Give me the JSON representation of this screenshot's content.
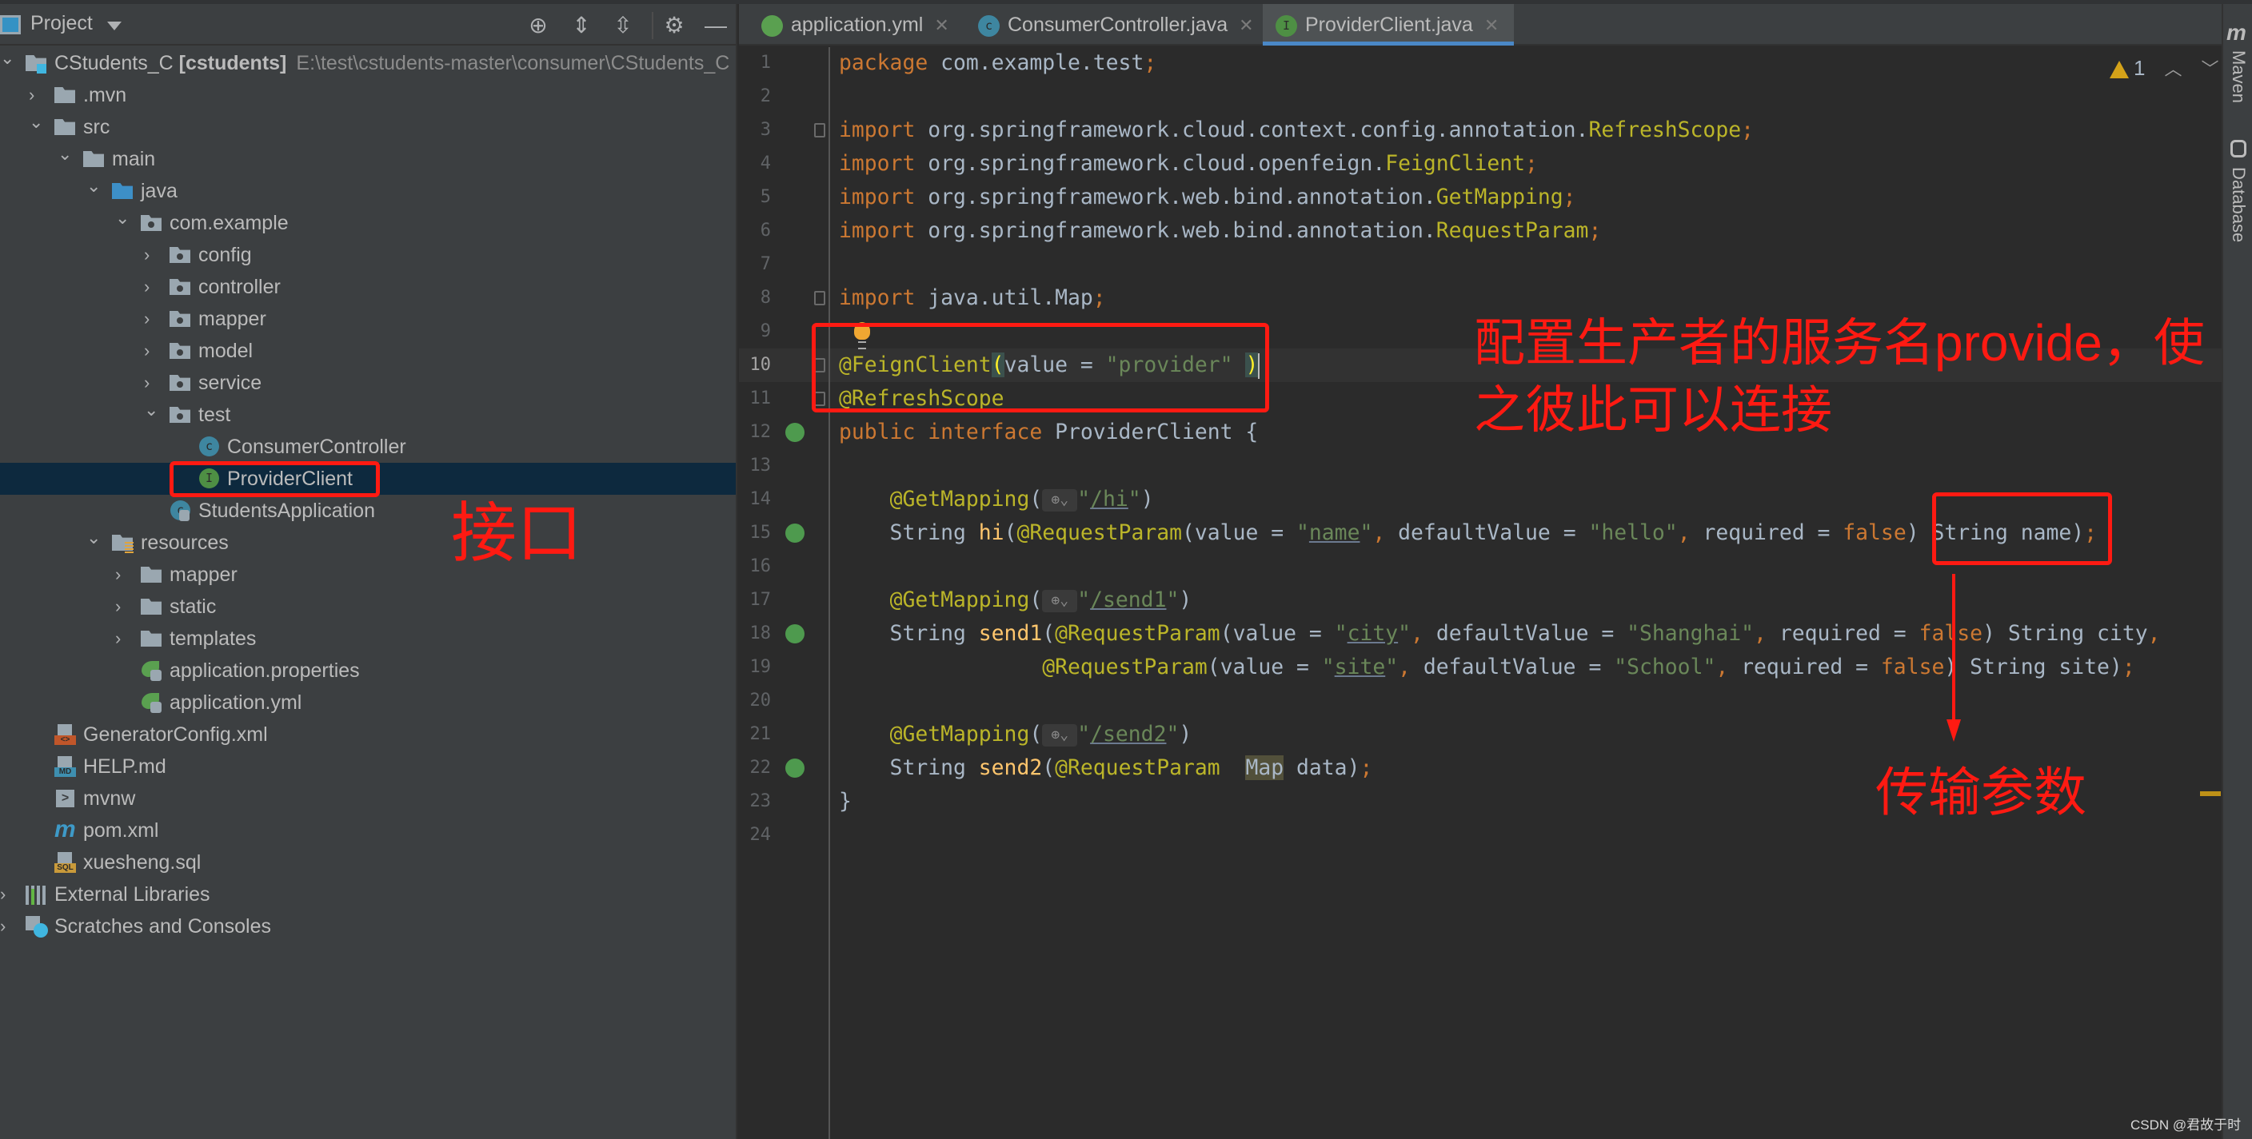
{
  "project_panel": {
    "title": "Project",
    "toolbar": [
      {
        "name": "locate-icon",
        "glyph": "⊕"
      },
      {
        "name": "expand-all-icon",
        "glyph": "⇕"
      },
      {
        "name": "collapse-all-icon",
        "glyph": "⇳"
      },
      {
        "name": "gear-icon",
        "glyph": "⚙"
      },
      {
        "name": "hide-icon",
        "glyph": "—"
      }
    ],
    "tree": [
      {
        "label": "CStudents_C",
        "bold": "[cstudents]",
        "path": "E:\\test\\cstudents-master\\consumer\\CStudents_C",
        "level": 0,
        "expanded": true,
        "icon": "module"
      },
      {
        "label": ".mvn",
        "level": 1,
        "expanded": false,
        "icon": "folder"
      },
      {
        "label": "src",
        "level": 1,
        "expanded": true,
        "icon": "folder"
      },
      {
        "label": "main",
        "level": 2,
        "expanded": true,
        "icon": "folder"
      },
      {
        "label": "java",
        "level": 3,
        "expanded": true,
        "icon": "src-folder"
      },
      {
        "label": "com.example",
        "level": 4,
        "expanded": true,
        "icon": "package"
      },
      {
        "label": "config",
        "level": 5,
        "expanded": false,
        "icon": "package"
      },
      {
        "label": "controller",
        "level": 5,
        "expanded": false,
        "icon": "package"
      },
      {
        "label": "mapper",
        "level": 5,
        "expanded": false,
        "icon": "package"
      },
      {
        "label": "model",
        "level": 5,
        "expanded": false,
        "icon": "package"
      },
      {
        "label": "service",
        "level": 5,
        "expanded": false,
        "icon": "package"
      },
      {
        "label": "test",
        "level": 5,
        "expanded": true,
        "icon": "package"
      },
      {
        "label": "ConsumerController",
        "level": 6,
        "icon": "class"
      },
      {
        "label": "ProviderClient",
        "level": 6,
        "icon": "interface",
        "selected": true
      },
      {
        "label": "StudentsApplication",
        "level": 5,
        "icon": "spring-app"
      },
      {
        "label": "resources",
        "level": 3,
        "expanded": true,
        "icon": "res-folder"
      },
      {
        "label": "mapper",
        "level": 4,
        "expanded": false,
        "icon": "folder"
      },
      {
        "label": "static",
        "level": 4,
        "expanded": false,
        "icon": "folder"
      },
      {
        "label": "templates",
        "level": 4,
        "expanded": false,
        "icon": "folder"
      },
      {
        "label": "application.properties",
        "level": 4,
        "icon": "spring-config"
      },
      {
        "label": "application.yml",
        "level": 4,
        "icon": "spring-config"
      },
      {
        "label": "GeneratorConfig.xml",
        "level": 1,
        "icon": "xml"
      },
      {
        "label": "HELP.md",
        "level": 1,
        "icon": "md"
      },
      {
        "label": "mvnw",
        "level": 1,
        "icon": "shell"
      },
      {
        "label": "pom.xml",
        "level": 1,
        "icon": "maven"
      },
      {
        "label": "xuesheng.sql",
        "level": 1,
        "icon": "sql"
      },
      {
        "label": "External Libraries",
        "level": 0,
        "expanded": false,
        "icon": "libraries"
      },
      {
        "label": "Scratches and Consoles",
        "level": 0,
        "expanded": false,
        "icon": "scratches"
      }
    ]
  },
  "tabs": [
    {
      "label": "application.yml",
      "icon": "spring-config",
      "active": false
    },
    {
      "label": "ConsumerController.java",
      "icon": "class",
      "active": false
    },
    {
      "label": "ProviderClient.java",
      "icon": "interface",
      "active": true
    }
  ],
  "editor": {
    "warnings": "1",
    "current_line": 10,
    "lines": [
      [
        [
          "k",
          "package"
        ],
        [
          "p",
          " com.example.test"
        ],
        [
          "k",
          ";"
        ]
      ],
      [],
      [
        [
          "k",
          "import"
        ],
        [
          "p",
          " org.springframework.cloud.context.config.annotation."
        ],
        [
          "a",
          "RefreshScope"
        ],
        [
          "k",
          ";"
        ]
      ],
      [
        [
          "k",
          "import"
        ],
        [
          "p",
          " org.springframework.cloud.openfeign."
        ],
        [
          "a",
          "FeignClient"
        ],
        [
          "k",
          ";"
        ]
      ],
      [
        [
          "k",
          "import"
        ],
        [
          "p",
          " org.springframework.web.bind.annotation."
        ],
        [
          "a",
          "GetMapping"
        ],
        [
          "k",
          ";"
        ]
      ],
      [
        [
          "k",
          "import"
        ],
        [
          "p",
          " org.springframework.web.bind.annotation."
        ],
        [
          "a",
          "RequestParam"
        ],
        [
          "k",
          ";"
        ]
      ],
      [],
      [
        [
          "k",
          "import"
        ],
        [
          "p",
          " java.util.Map"
        ],
        [
          "k",
          ";"
        ]
      ],
      [],
      [
        [
          "a",
          "@FeignClient"
        ],
        [
          "bm",
          "("
        ],
        [
          "p",
          "value = "
        ],
        [
          "s",
          "\"provider\""
        ],
        [
          "p",
          " "
        ],
        [
          "bm",
          ")"
        ]
      ],
      [
        [
          "a",
          "@RefreshScope"
        ]
      ],
      [
        [
          "k",
          "public interface "
        ],
        [
          "p",
          "ProviderClient {"
        ]
      ],
      [],
      [
        [
          "p",
          "    "
        ],
        [
          "a",
          "@GetMapping"
        ],
        [
          "p",
          "("
        ],
        [
          "h",
          "⊕⌄"
        ],
        [
          "s",
          "\""
        ],
        [
          "su",
          "/hi"
        ],
        [
          "s",
          "\""
        ],
        [
          "p",
          ")"
        ]
      ],
      [
        [
          "p",
          "    String "
        ],
        [
          "m",
          "hi"
        ],
        [
          "p",
          "("
        ],
        [
          "a",
          "@RequestParam"
        ],
        [
          "p",
          "(value = "
        ],
        [
          "s",
          "\""
        ],
        [
          "su",
          "name"
        ],
        [
          "s",
          "\""
        ],
        [
          "k",
          ", "
        ],
        [
          "p",
          "defaultValue = "
        ],
        [
          "s",
          "\"hello\""
        ],
        [
          "k",
          ", "
        ],
        [
          "p",
          "required = "
        ],
        [
          "k",
          "false"
        ],
        [
          "p",
          ") String name)"
        ],
        [
          "k",
          ";"
        ]
      ],
      [],
      [
        [
          "p",
          "    "
        ],
        [
          "a",
          "@GetMapping"
        ],
        [
          "p",
          "("
        ],
        [
          "h",
          "⊕⌄"
        ],
        [
          "s",
          "\""
        ],
        [
          "su",
          "/send1"
        ],
        [
          "s",
          "\""
        ],
        [
          "p",
          ")"
        ]
      ],
      [
        [
          "p",
          "    String "
        ],
        [
          "m",
          "send1"
        ],
        [
          "p",
          "("
        ],
        [
          "a",
          "@RequestParam"
        ],
        [
          "p",
          "(value = "
        ],
        [
          "s",
          "\""
        ],
        [
          "su",
          "city"
        ],
        [
          "s",
          "\""
        ],
        [
          "k",
          ", "
        ],
        [
          "p",
          "defaultValue = "
        ],
        [
          "s",
          "\"Shanghai\""
        ],
        [
          "k",
          ", "
        ],
        [
          "p",
          "required = "
        ],
        [
          "k",
          "false"
        ],
        [
          "p",
          ") String city"
        ],
        [
          "k",
          ","
        ]
      ],
      [
        [
          "p",
          "                "
        ],
        [
          "a",
          "@RequestParam"
        ],
        [
          "p",
          "(value = "
        ],
        [
          "s",
          "\""
        ],
        [
          "su",
          "site"
        ],
        [
          "s",
          "\""
        ],
        [
          "k",
          ", "
        ],
        [
          "p",
          "defaultValue = "
        ],
        [
          "s",
          "\"School\""
        ],
        [
          "k",
          ", "
        ],
        [
          "p",
          "required = "
        ],
        [
          "k",
          "false"
        ],
        [
          "p",
          ") String site)"
        ],
        [
          "k",
          ";"
        ]
      ],
      [],
      [
        [
          "p",
          "    "
        ],
        [
          "a",
          "@GetMapping"
        ],
        [
          "p",
          "("
        ],
        [
          "h",
          "⊕⌄"
        ],
        [
          "s",
          "\""
        ],
        [
          "su",
          "/send2"
        ],
        [
          "s",
          "\""
        ],
        [
          "p",
          ")"
        ]
      ],
      [
        [
          "p",
          "    String "
        ],
        [
          "m",
          "send2"
        ],
        [
          "p",
          "("
        ],
        [
          "a",
          "@RequestParam  "
        ],
        [
          "hl",
          "Map"
        ],
        [
          "p",
          " data)"
        ],
        [
          "k",
          ";"
        ]
      ],
      [
        [
          "p",
          "}"
        ]
      ],
      []
    ],
    "fold_lines": [
      3,
      8,
      10,
      11
    ],
    "impl_marker_lines": [
      12,
      15,
      18,
      22
    ]
  },
  "right_strip": {
    "maven": "Maven",
    "database": "Database"
  },
  "annotations": {
    "interface_label": "接口",
    "feign_note_line1": "配置生产者的服务名provide，使",
    "feign_note_line2": "之彼此可以连接",
    "params_label": "传输参数",
    "color": "#ff1a12"
  },
  "watermark": "CSDN @君故于时",
  "colors": {
    "keyword": "#cc7832",
    "annotation": "#bbb529",
    "string": "#6a8759",
    "text": "#a9b7c6",
    "method": "#ffc66d",
    "selection": "#0d293e",
    "accent": "#4a88c7"
  }
}
